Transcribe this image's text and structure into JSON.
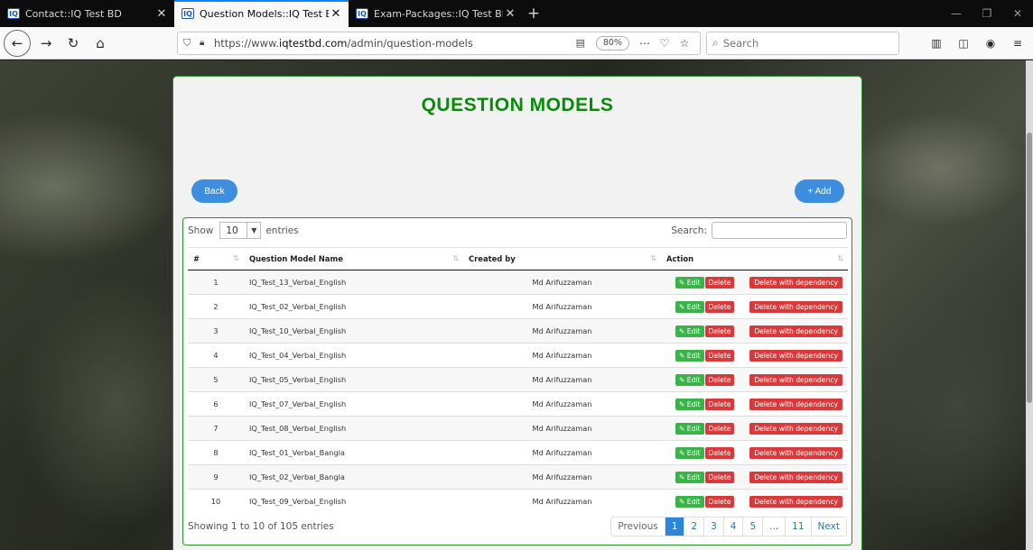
{
  "browser": {
    "tabs": [
      {
        "label": "Contact::IQ Test BD",
        "active": false
      },
      {
        "label": "Question Models::IQ Test BD",
        "active": true
      },
      {
        "label": "Exam-Packages::IQ Test BD",
        "active": false
      }
    ],
    "favicon_text": "IQ",
    "url_prefix": "https://www.",
    "url_domain": "iqtestbd.com",
    "url_path": "/admin/question-models",
    "zoom": "80%",
    "search_placeholder": "Search"
  },
  "page": {
    "title": "QUESTION MODELS",
    "back_label": "Back",
    "add_label": "+ Add"
  },
  "table": {
    "show_label": "Show",
    "page_length": "10",
    "entries_label": "entries",
    "search_label": "Search:",
    "columns": [
      "#",
      "Question Model Name",
      "Created by",
      "Action"
    ],
    "rows": [
      {
        "num": "1",
        "name": "IQ_Test_13_Verbal_English",
        "creator": "Md Arifuzzaman"
      },
      {
        "num": "2",
        "name": "IQ_Test_02_Verbal_English",
        "creator": "Md Arifuzzaman"
      },
      {
        "num": "3",
        "name": "IQ_Test_10_Verbal_English",
        "creator": "Md Arifuzzaman"
      },
      {
        "num": "4",
        "name": "IQ_Test_04_Verbal_English",
        "creator": "Md Arifuzzaman"
      },
      {
        "num": "5",
        "name": "IQ_Test_05_Verbal_English",
        "creator": "Md Arifuzzaman"
      },
      {
        "num": "6",
        "name": "IQ_Test_07_Verbal_English",
        "creator": "Md Arifuzzaman"
      },
      {
        "num": "7",
        "name": "IQ_Test_08_Verbal_English",
        "creator": "Md Arifuzzaman"
      },
      {
        "num": "8",
        "name": "IQ_Test_01_Verbal_Bangla",
        "creator": "Md Arifuzzaman"
      },
      {
        "num": "9",
        "name": "IQ_Test_02_Verbal_Bangla",
        "creator": "Md Arifuzzaman"
      },
      {
        "num": "10",
        "name": "IQ_Test_09_Verbal_English",
        "creator": "Md Arifuzzaman"
      }
    ],
    "edit_label": "Edit",
    "delete_label": "Delete",
    "delete_dep_label": "Delete with dependency",
    "info": "Showing 1 to 10 of 105 entries",
    "pagination": [
      "Previous",
      "1",
      "2",
      "3",
      "4",
      "5",
      "...",
      "11",
      "Next"
    ],
    "active_page": "1"
  },
  "colors": {
    "title_green": "#0a8a0a",
    "primary_blue": "#3e8ee0",
    "edit_green": "#3cb34a",
    "delete_red": "#d9393a"
  }
}
